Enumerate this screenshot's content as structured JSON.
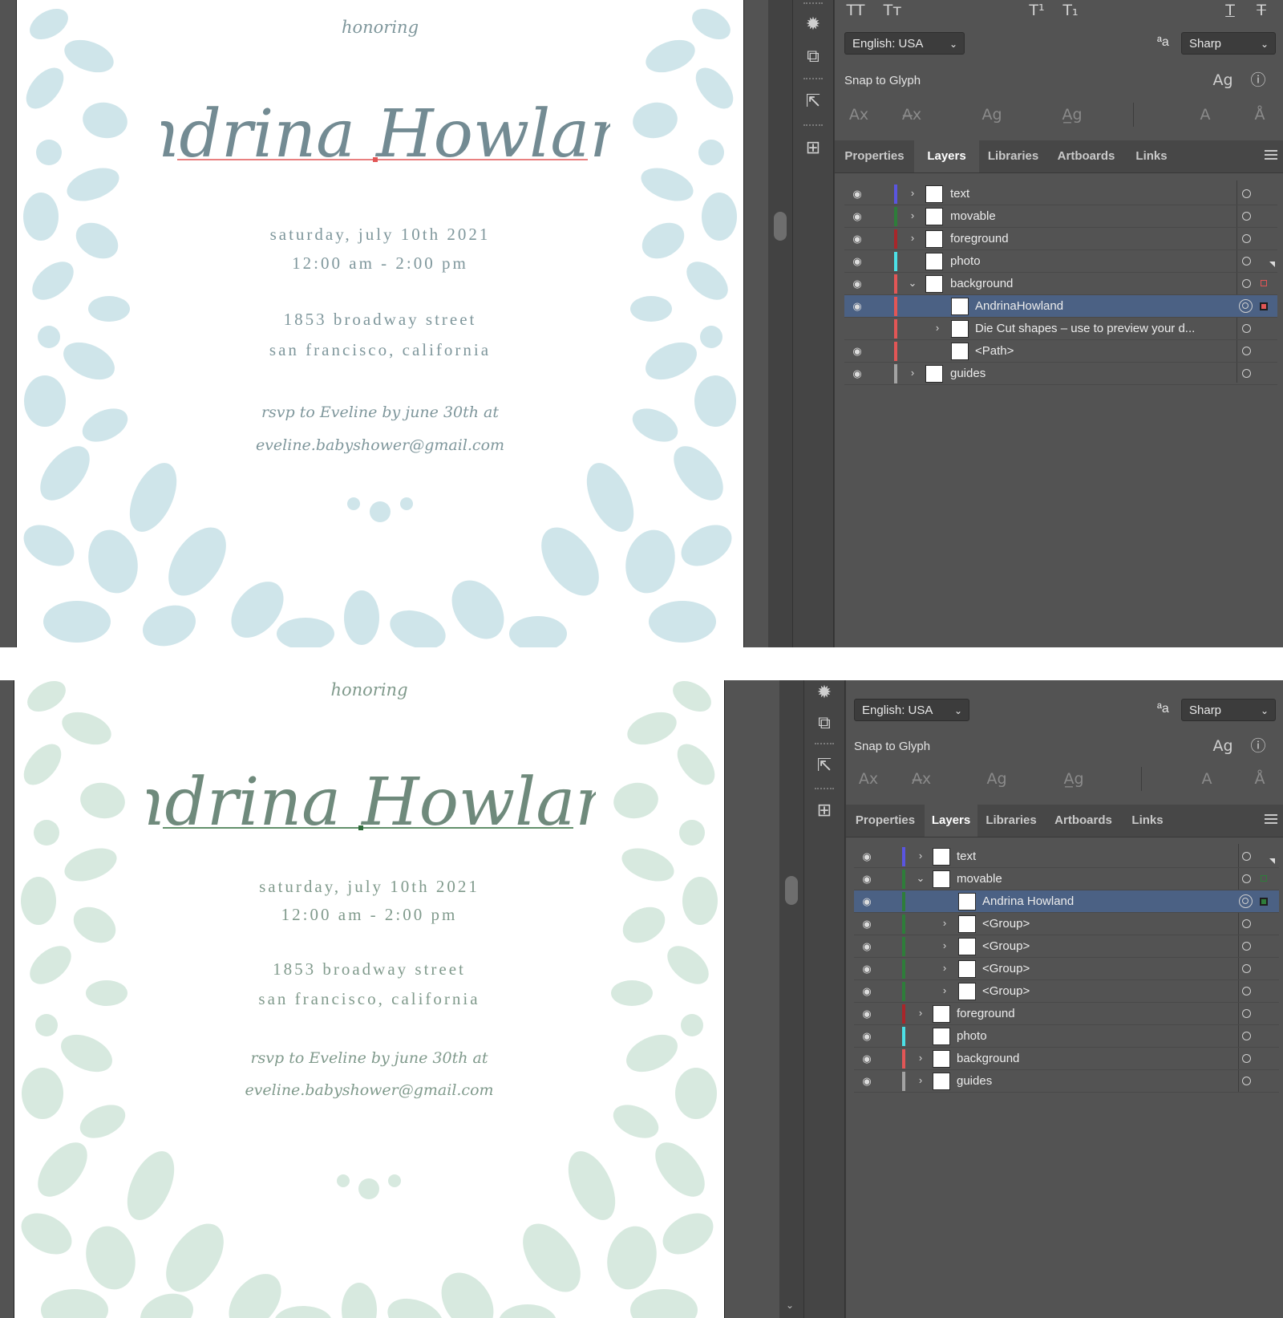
{
  "top": {
    "card": {
      "honoring": "honoring",
      "name": "Andrina Howland",
      "date_line": "saturday, july 10th 2021",
      "time_line": "12:00 am - 2:00 pm",
      "street_line": "1853 broadway street",
      "city_line": "san francisco, california",
      "rsvp_line": "rsvp to Eveline by june 30th at",
      "email_line": "eveline.babyshower@gmail.com",
      "floral_color": "#cfe5ea",
      "text_color": "#7f979c",
      "script_color": "#738b93",
      "baseline_color": "#e25656"
    },
    "char_panel": {
      "language": "English: USA",
      "antialias": "Sharp",
      "snap_label": "Snap to Glyph"
    },
    "tabs": [
      "Properties",
      "Layers",
      "Libraries",
      "Artboards",
      "Links"
    ],
    "active_tab": "Layers",
    "layers": [
      {
        "name": "text",
        "color": "#5a55e0"
      },
      {
        "name": "movable",
        "color": "#2e7d3a"
      },
      {
        "name": "foreground",
        "color": "#a8262a"
      },
      {
        "name": "photo",
        "color": "#4ce0e6"
      },
      {
        "name": "background",
        "color": "#e25656"
      },
      {
        "name": "AndrinaHowland",
        "color": "#e25656"
      },
      {
        "name": "Die Cut shapes – use to preview your d...",
        "color": "#e25656"
      },
      {
        "name": "<Path>",
        "color": "#e25656"
      },
      {
        "name": "guides",
        "color": "#a3a3a3"
      }
    ]
  },
  "bottom": {
    "card": {
      "honoring": "honoring",
      "name": "Andrina Howland",
      "date_line": "saturday, july 10th 2021",
      "time_line": "12:00 am - 2:00 pm",
      "street_line": "1853 broadway street",
      "city_line": "san francisco, california",
      "rsvp_line": "rsvp to Eveline by june 30th at",
      "email_line": "eveline.babyshower@gmail.com",
      "floral_color": "#d7e9df",
      "text_color": "#809a8c",
      "script_color": "#6f8a7c",
      "baseline_color": "#2e6b3a"
    },
    "char_panel": {
      "language": "English: USA",
      "antialias": "Sharp",
      "snap_label": "Snap to Glyph"
    },
    "tabs": [
      "Properties",
      "Layers",
      "Libraries",
      "Artboards",
      "Links"
    ],
    "active_tab": "Layers",
    "layers": [
      {
        "name": "text",
        "color": "#5a55e0"
      },
      {
        "name": "movable",
        "color": "#2e7d3a"
      },
      {
        "name": "Andrina Howland",
        "color": "#2e7d3a"
      },
      {
        "name": "<Group>",
        "color": "#2e7d3a"
      },
      {
        "name": "<Group>",
        "color": "#2e7d3a"
      },
      {
        "name": "<Group>",
        "color": "#2e7d3a"
      },
      {
        "name": "<Group>",
        "color": "#2e7d3a"
      },
      {
        "name": "foreground",
        "color": "#a8262a"
      },
      {
        "name": "photo",
        "color": "#4ce0e6"
      },
      {
        "name": "background",
        "color": "#e25656"
      },
      {
        "name": "guides",
        "color": "#a3a3a3"
      }
    ]
  }
}
